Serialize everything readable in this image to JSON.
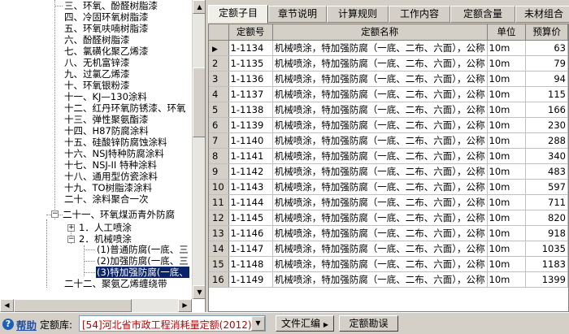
{
  "tree": {
    "items": [
      {
        "label": "三、环氧、酚醛树脂漆"
      },
      {
        "label": "四、冷固环氧树脂漆"
      },
      {
        "label": "五、环氧呋喃树脂漆"
      },
      {
        "label": "六、酚醛树脂漆"
      },
      {
        "label": "七、氯磺化聚乙烯漆"
      },
      {
        "label": "八、无机富锌漆"
      },
      {
        "label": "九、过氯乙烯漆"
      },
      {
        "label": "十、环氧银粉漆"
      },
      {
        "label": "十一、KJ—130涂料"
      },
      {
        "label": "十二、红丹环氧防锈漆、环氧"
      },
      {
        "label": "十三、弹性聚氨酯漆"
      },
      {
        "label": "十四、H87防腐涂料"
      },
      {
        "label": "十五、硅酸锌防腐蚀涂料"
      },
      {
        "label": "十六、NSJ特种防腐涂料"
      },
      {
        "label": "十七、NSJ-II 特种涂料"
      },
      {
        "label": "十八、通用型仿瓷涂料"
      },
      {
        "label": "十九、TO树脂漆涂料"
      },
      {
        "label": "二十、涂料聚合一次"
      },
      {
        "label": "二十一、环氧煤沥青外防腐"
      },
      {
        "label": "1．人工喷涂"
      },
      {
        "label": "2．机械喷涂"
      },
      {
        "label": "(1)普通防腐(一底、三"
      },
      {
        "label": "(2)加强防腐(一底、三"
      },
      {
        "label": "(3)特加强防腐(一底、"
      },
      {
        "label": "二十二、聚氨乙烯缠绕带"
      }
    ],
    "expanders": {
      "expanded": "−",
      "collapsed": "+"
    }
  },
  "tabs": [
    {
      "label": "定额子目"
    },
    {
      "label": "章节说明"
    },
    {
      "label": "计算规则"
    },
    {
      "label": "工作内容"
    },
    {
      "label": "定额含量"
    },
    {
      "label": "未材组合"
    }
  ],
  "grid": {
    "headers": {
      "code": "定额号",
      "name": "定额名称",
      "unit": "单位",
      "price": "预算价"
    },
    "current_row_marker": "▶",
    "rows": [
      {
        "idx": "1",
        "code": "1-1134",
        "name": "机械喷涂，特加强防腐（一底、二布、六面），公称",
        "unit": "10m",
        "price": "63"
      },
      {
        "idx": "2",
        "code": "1-1135",
        "name": "机械喷涂，特加强防腐（一底、二布、六面），公称",
        "unit": "10m",
        "price": "79"
      },
      {
        "idx": "3",
        "code": "1-1136",
        "name": "机械喷涂，特加强防腐（一底、二布、六面），公称",
        "unit": "10m",
        "price": "94"
      },
      {
        "idx": "4",
        "code": "1-1137",
        "name": "机械喷涂，特加强防腐（一底、二布、六面），公称",
        "unit": "10m",
        "price": "115"
      },
      {
        "idx": "5",
        "code": "1-1138",
        "name": "机械喷涂，特加强防腐（一底、二布、六面），公称",
        "unit": "10m",
        "price": "166"
      },
      {
        "idx": "6",
        "code": "1-1139",
        "name": "机械喷涂，特加强防腐（一底、二布、六面），公称",
        "unit": "10m",
        "price": "230"
      },
      {
        "idx": "7",
        "code": "1-1140",
        "name": "机械喷涂，特加强防腐（一底、二布、六面），公称",
        "unit": "10m",
        "price": "288"
      },
      {
        "idx": "8",
        "code": "1-1141",
        "name": "机械喷涂，特加强防腐（一底、二布、六面），公称",
        "unit": "10m",
        "price": "340"
      },
      {
        "idx": "9",
        "code": "1-1142",
        "name": "机械喷涂，特加强防腐（一底、二布、六面），公称",
        "unit": "10m",
        "price": "483"
      },
      {
        "idx": "10",
        "code": "1-1143",
        "name": "机械喷涂，特加强防腐（一底、二布、六面），公称",
        "unit": "10m",
        "price": "597"
      },
      {
        "idx": "11",
        "code": "1-1144",
        "name": "机械喷涂，特加强防腐（一底、二布、六面），公称",
        "unit": "10m",
        "price": "711"
      },
      {
        "idx": "12",
        "code": "1-1145",
        "name": "机械喷涂，特加强防腐（一底、二布、六面），公称",
        "unit": "10m",
        "price": "820"
      },
      {
        "idx": "13",
        "code": "1-1146",
        "name": "机械喷涂，特加强防腐（一底、二布、六面），公称",
        "unit": "10m",
        "price": "918"
      },
      {
        "idx": "14",
        "code": "1-1147",
        "name": "机械喷涂，特加强防腐（一底、二布、六面），公称",
        "unit": "10m",
        "price": "1035"
      },
      {
        "idx": "15",
        "code": "1-1148",
        "name": "机械喷涂，特加强防腐（一底、二布、六面），公称",
        "unit": "10m",
        "price": "1183"
      },
      {
        "idx": "16",
        "code": "1-1149",
        "name": "机械喷涂，特加强防腐（一底、二布、六面），公称",
        "unit": "10m",
        "price": "1399"
      }
    ]
  },
  "bottom": {
    "help_icon": "?",
    "help_label": "帮助",
    "library_label": "定额库:",
    "library_value": "[54]河北省市政工程消耗量定额(2012)",
    "doc_button": "文件汇编",
    "errata_button": "定额勘误"
  },
  "colors": {
    "selection": "#0a246a",
    "library_text": "#c00000",
    "help_link": "#1d4fa8"
  }
}
